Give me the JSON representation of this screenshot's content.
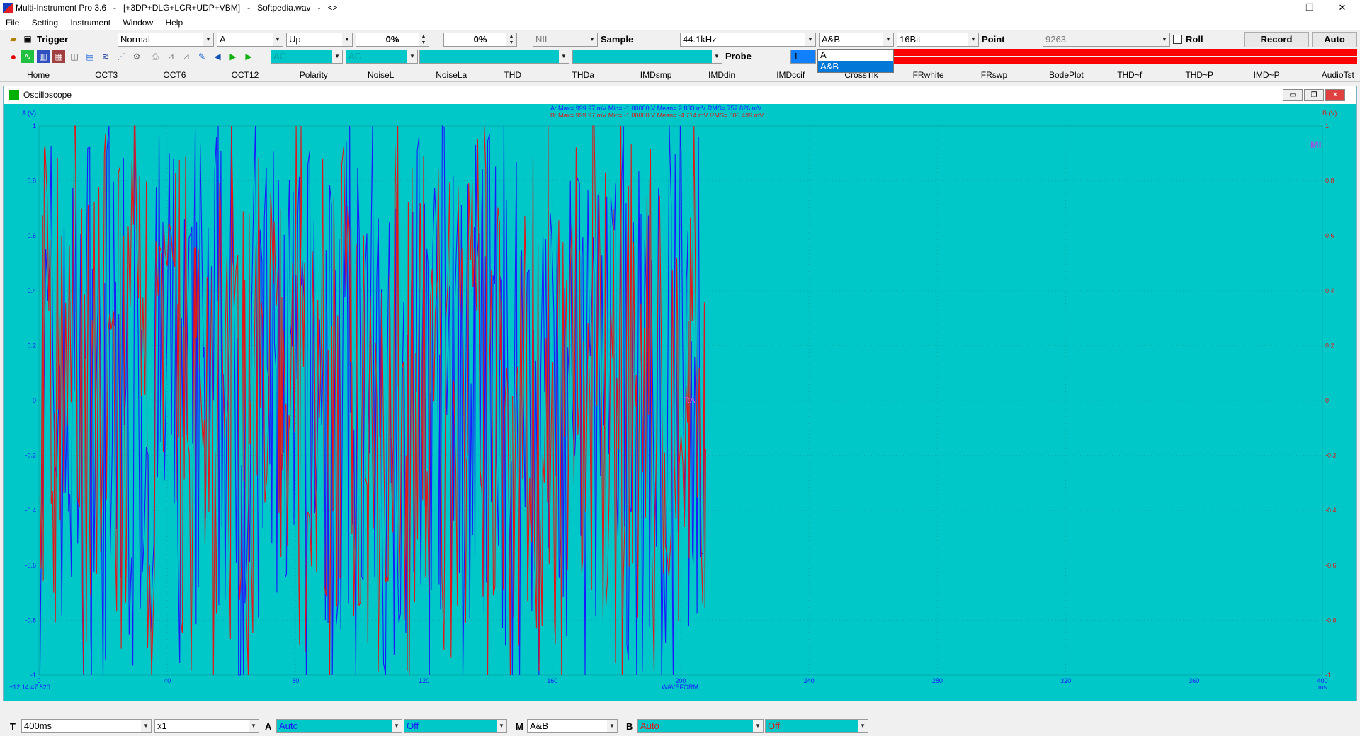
{
  "window": {
    "title": "Multi-Instrument Pro 3.6   -   [+3DP+DLG+LCR+UDP+VBM]   -   Softpedia.wav   -   <>",
    "min": "—",
    "max": "❐",
    "close": "✕"
  },
  "menu": [
    "File",
    "Setting",
    "Instrument",
    "Window",
    "Help"
  ],
  "toolbar1": {
    "trigger_label": "Trigger",
    "trigger_mode": "Normal",
    "trigger_channel": "A",
    "trigger_edge": "Up",
    "level_a": "0%",
    "level_b": "0%",
    "nil": "NIL",
    "sample_label": "Sample",
    "sample_rate": "44.1kHz",
    "channel": "A&B",
    "bits": "16Bit",
    "point_label": "Point",
    "points": "9263",
    "roll_label": "Roll",
    "record_label": "Record",
    "auto_label": "Auto"
  },
  "toolbar2": {
    "coupling_a": "AC",
    "coupling_b": "AC",
    "probe_label": "Probe",
    "probe_value": "1"
  },
  "channel_dropdown": {
    "options": [
      "A",
      "A&B"
    ],
    "selected": "A&B"
  },
  "tabs": [
    "Home",
    "OCT3",
    "OCT6",
    "OCT12",
    "Polarity",
    "NoiseL",
    "NoiseLa",
    "THD",
    "THDa",
    "IMDsmp",
    "IMDdin",
    "IMDccif",
    "CrossTlk",
    "FRwhite",
    "FRswp",
    "BodePlot",
    "THD~f",
    "THD~P",
    "IMD~P",
    "AudioTst"
  ],
  "oscilloscope": {
    "title": "Oscilloscope",
    "stats_a": "A: Max=    999.97  mV  Min=  -1.00000   V  Mean=       2.833  mV  RMS=   757.826  mV",
    "stats_b": "B: Max=    999.97  mV  Min=  -1.00000   V  Mean=      -4.714  mV  RMS=   803.499  mV",
    "left_axis_label": "A (V)",
    "right_axis_label": "B (V)",
    "y_ticks": [
      "1",
      "0.8",
      "0.6",
      "0.4",
      "0.2",
      "0",
      "-0.2",
      "-0.4",
      "-0.6",
      "-0.8",
      "-1"
    ],
    "x_ticks": [
      "0",
      "40",
      "80",
      "120",
      "160",
      "200",
      "240",
      "280",
      "320",
      "360",
      "400"
    ],
    "x_unit": "ms",
    "x_label": "WAVEFORM",
    "timestamp": "+12:14:47:820",
    "marker": "MI",
    "trigger_marker": "T:A",
    "colors": {
      "bg": "#00c8c8",
      "a": "#1a1aff",
      "b": "#e01818",
      "grid": "#00aaaa"
    }
  },
  "bottom": {
    "t_label": "T",
    "timebase": "400ms",
    "zoom": "x1",
    "a_label": "A",
    "a_range": "Auto",
    "a_off": "Off",
    "m_label": "M",
    "m_value": "A&B",
    "b_label": "B",
    "b_range": "Auto",
    "b_off": "Off"
  }
}
